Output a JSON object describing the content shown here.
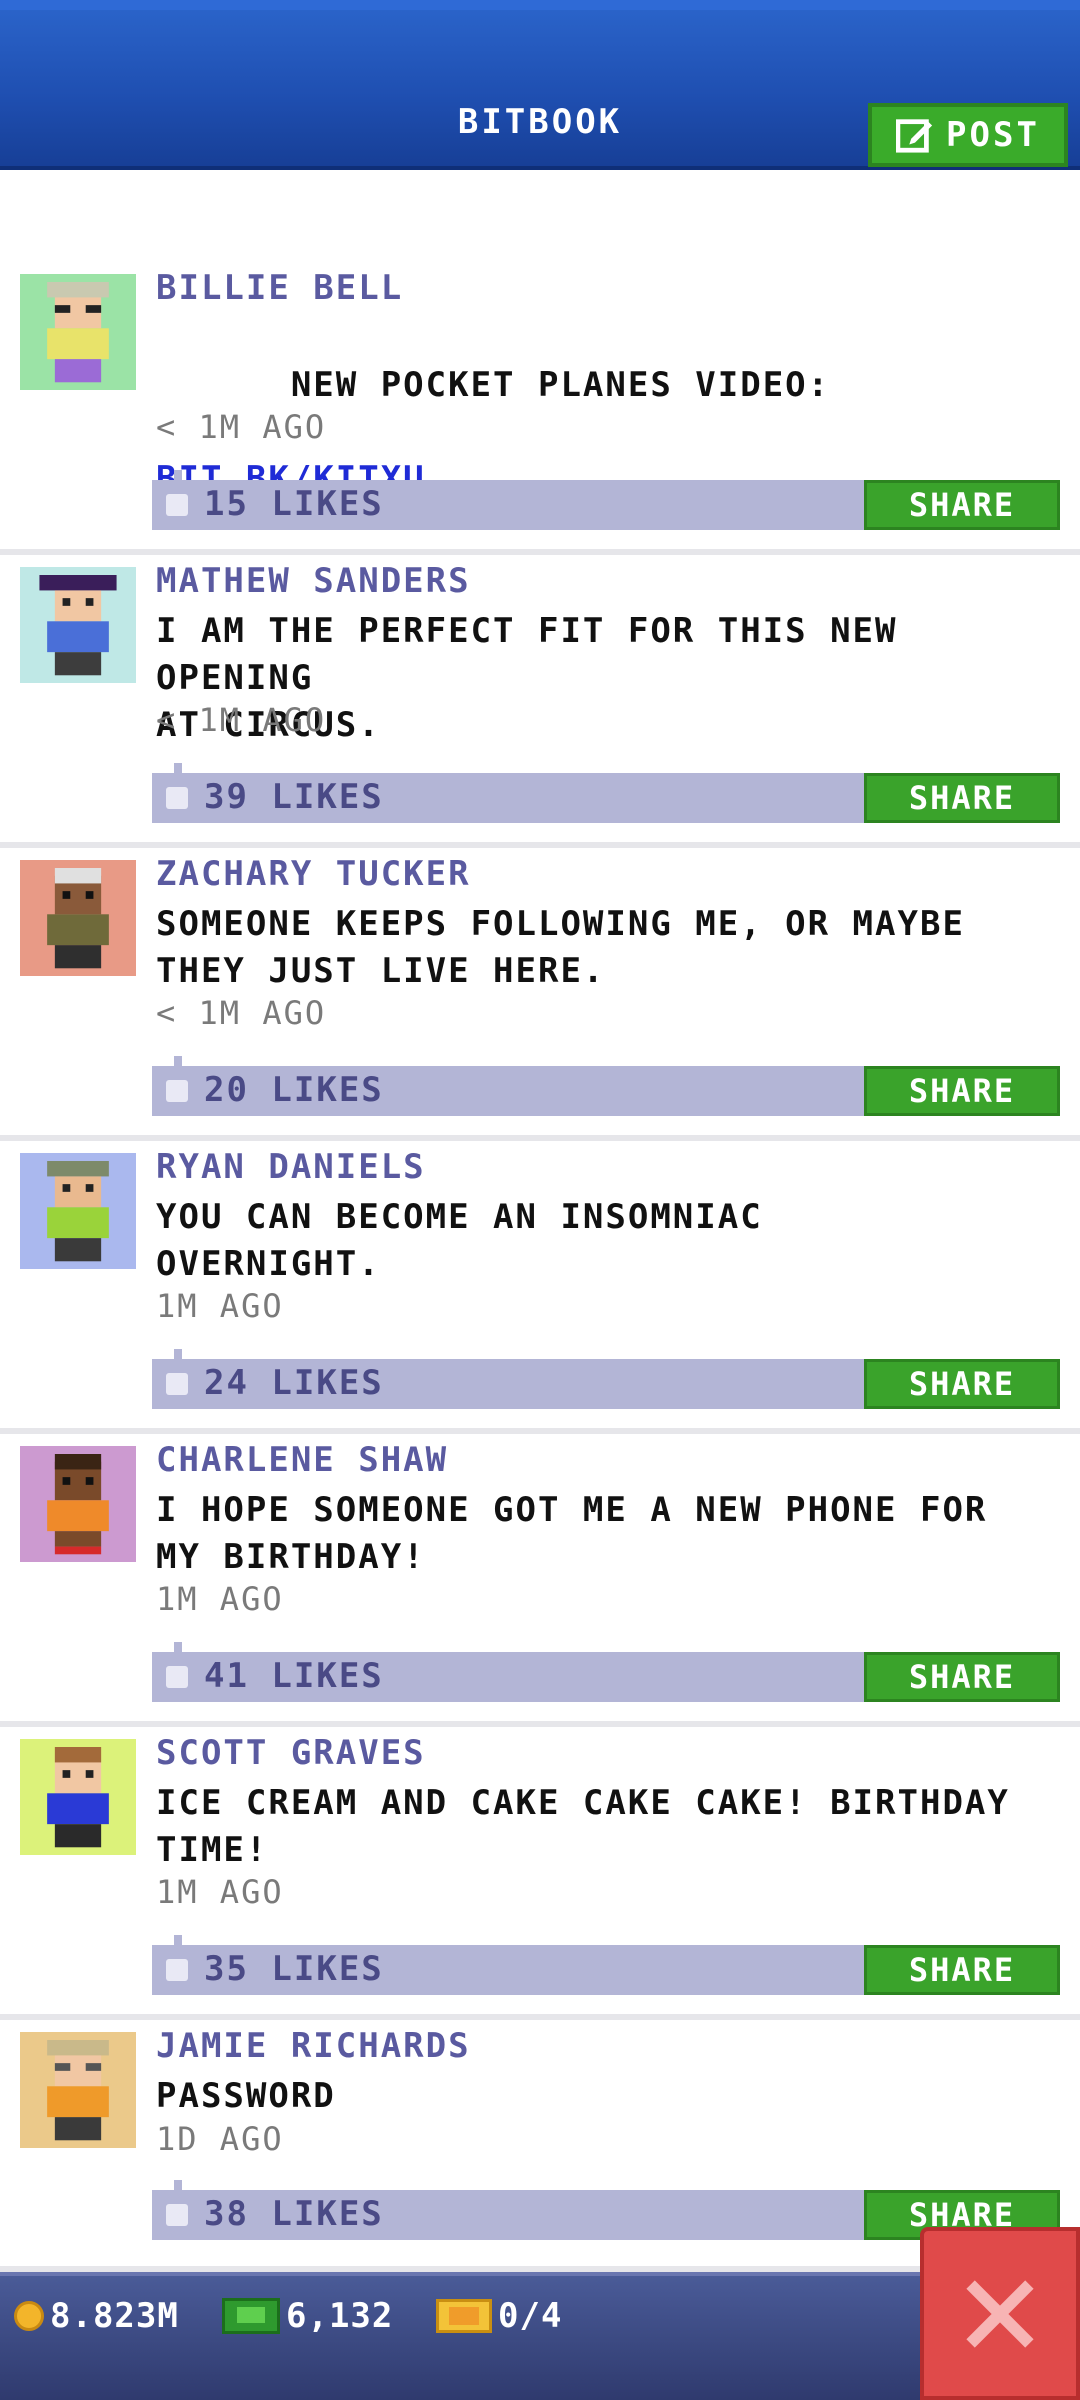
{
  "header": {
    "title": "BITBOOK",
    "post_label": "POST"
  },
  "posts": [
    {
      "author": "BILLIE BELL",
      "text": "NEW POCKET PLANES VIDEO:",
      "link": "BIT.BK/KITXU",
      "time": "< 1M AGO",
      "likes": "15 LIKES",
      "share": "SHARE",
      "avatar_bg": "#9be3a6"
    },
    {
      "author": "MATHEW SANDERS",
      "text": "I AM THE PERFECT FIT FOR THIS NEW OPENING\nAT CIRCUS.",
      "time": "< 1M AGO",
      "likes": "39 LIKES",
      "share": "SHARE",
      "avatar_bg": "#bfe8e6"
    },
    {
      "author": "ZACHARY TUCKER",
      "text": "SOMEONE KEEPS FOLLOWING ME, OR MAYBE\nTHEY JUST LIVE HERE.",
      "time": "< 1M AGO",
      "likes": "20 LIKES",
      "share": "SHARE",
      "avatar_bg": "#e89a86"
    },
    {
      "author": "RYAN DANIELS",
      "text": "YOU CAN BECOME AN INSOMNIAC\nOVERNIGHT.",
      "time": "1M AGO",
      "likes": "24 LIKES",
      "share": "SHARE",
      "avatar_bg": "#aab8ee"
    },
    {
      "author": "CHARLENE SHAW",
      "text": "I HOPE SOMEONE GOT ME A NEW PHONE FOR\nMY BIRTHDAY!",
      "time": "1M AGO",
      "likes": "41 LIKES",
      "share": "SHARE",
      "avatar_bg": "#cc9ad0"
    },
    {
      "author": "SCOTT GRAVES",
      "text": "ICE CREAM AND CAKE CAKE CAKE! BIRTHDAY\nTIME!",
      "time": "1M AGO",
      "likes": "35 LIKES",
      "share": "SHARE",
      "avatar_bg": "#dcf27a"
    },
    {
      "author": "JAMIE RICHARDS",
      "text": "PASSWORD",
      "time": "1D AGO",
      "likes": "38 LIKES",
      "share": "SHARE",
      "avatar_bg": "#ebc98a"
    }
  ],
  "bottom_bar": {
    "coins": "8.823M",
    "bux": "6,132",
    "tickets": "0/4"
  },
  "colors": {
    "header_blue": "#1f4fb1",
    "share_green": "#3aa32b",
    "likes_bar": "#b3b5d6",
    "close_red": "#e04a4a"
  }
}
